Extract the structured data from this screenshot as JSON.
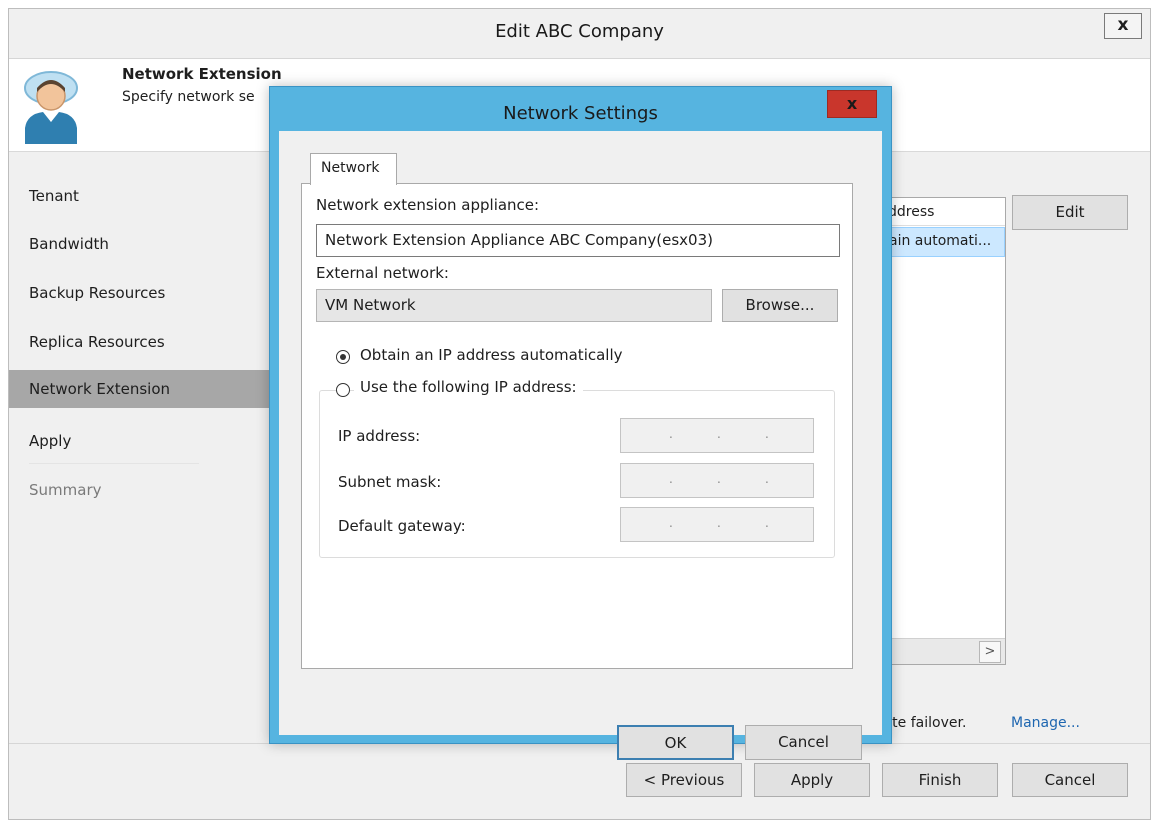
{
  "window": {
    "title": "Edit ABC Company",
    "close_label": "x"
  },
  "header": {
    "title": "Network Extension",
    "subtitle": "Specify network se",
    "icon": "user-cloud-icon"
  },
  "nav": {
    "items": [
      {
        "label": "Tenant",
        "state": "normal"
      },
      {
        "label": "Bandwidth",
        "state": "normal"
      },
      {
        "label": "Backup Resources",
        "state": "normal"
      },
      {
        "label": "Replica Resources",
        "state": "normal"
      },
      {
        "label": "Network Extension",
        "state": "active"
      },
      {
        "label": "Apply",
        "state": "normal"
      },
      {
        "label": "Summary",
        "state": "disabled"
      }
    ]
  },
  "appliance_list": {
    "header": "ddress",
    "row_value": "ain automati...",
    "scroll_right_label": ">"
  },
  "buttons": {
    "edit": "Edit",
    "previous": "< Previous",
    "apply": "Apply",
    "finish": "Finish",
    "cancel": "Cancel"
  },
  "footer": {
    "failover_text": "site failover.",
    "manage_link": "Manage..."
  },
  "dialog": {
    "title": "Network Settings",
    "close_label": "x",
    "tab": "Network",
    "appliance_label": "Network extension appliance:",
    "appliance_value": "Network Extension Appliance ABC Company(esx03)",
    "external_network_label": "External network:",
    "external_network_value": "VM Network",
    "browse_label": "Browse...",
    "radio_auto": "Obtain an IP address automatically",
    "radio_manual": "Use the following IP address:",
    "selected_option": "auto",
    "ip_label": "IP address:",
    "subnet_label": "Subnet mask:",
    "gateway_label": "Default gateway:",
    "ip_dots": ".",
    "ok_label": "OK",
    "cancel_label": "Cancel"
  },
  "colors": {
    "dialog_frame": "#56b4e0",
    "close_button": "#c9362c",
    "nav_active": "#a7a7a7",
    "list_selection": "#cce8ff",
    "link": "#1e66b0"
  }
}
